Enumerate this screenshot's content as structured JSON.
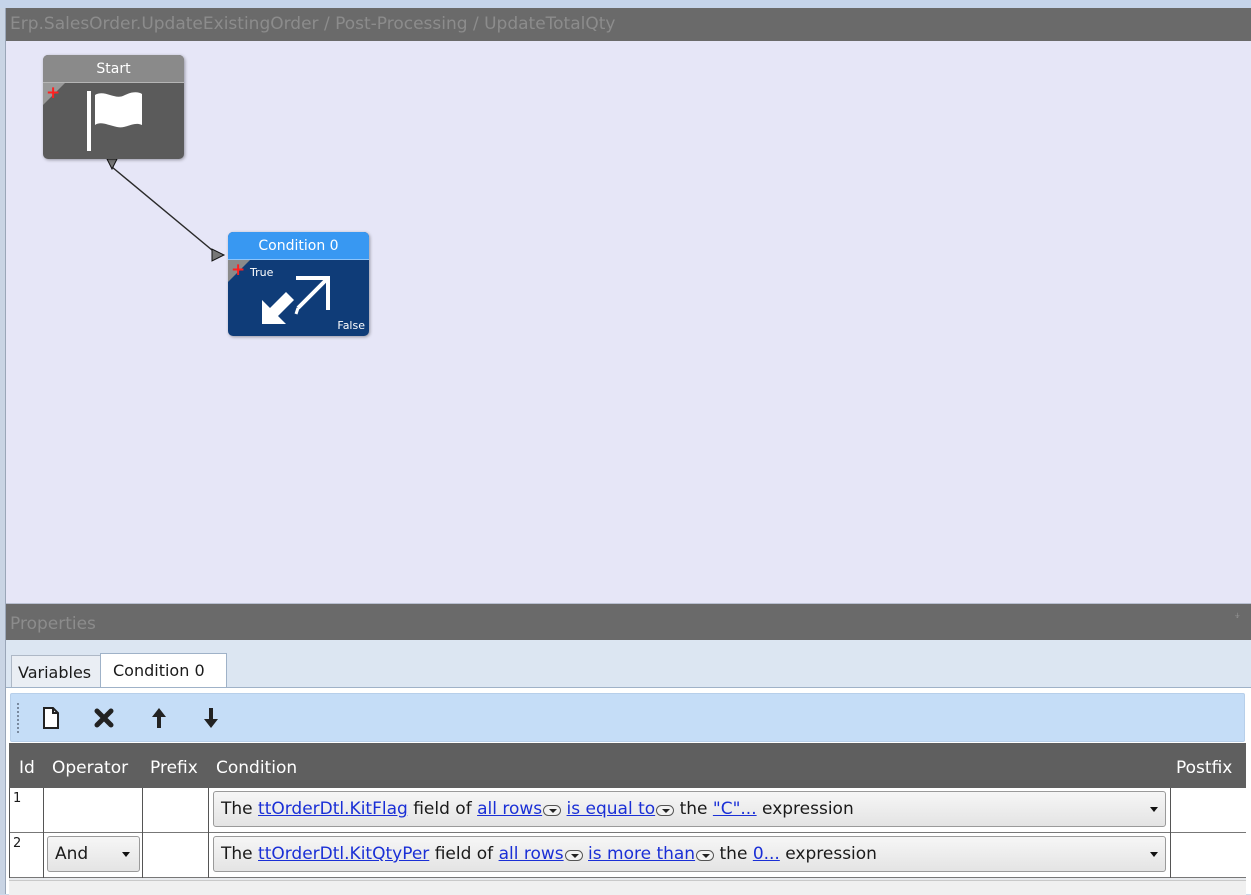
{
  "breadcrumb": "Erp.SalesOrder.UpdateExistingOrder / Post-Processing / UpdateTotalQty",
  "canvas": {
    "nodes": [
      {
        "title": "Start",
        "icon": "flag-icon"
      },
      {
        "title": "Condition 0",
        "icon": "condition-arrows-icon",
        "true_label": "True",
        "false_label": "False"
      }
    ],
    "add_glyph": "+"
  },
  "properties": {
    "title": "Properties",
    "pin_glyph": "⍖",
    "tabs": [
      {
        "label": "Variables",
        "selected": false
      },
      {
        "label": "Condition 0",
        "selected": true
      }
    ],
    "toolbar": [
      "new-icon",
      "delete-icon",
      "move-up-icon",
      "move-down-icon"
    ],
    "columns": {
      "id": "Id",
      "operator": "Operator",
      "prefix": "Prefix",
      "condition": "Condition",
      "postfix": "Postfix"
    },
    "rows": [
      {
        "id": "1",
        "operator": "",
        "prefix": "",
        "condition": {
          "p1": "The ",
          "field": "ttOrderDtl.KitFlag",
          "p2": " field of ",
          "rows": "all rows",
          "p3": " ",
          "compare": "is equal to",
          "p4": " the ",
          "value": "\"C\"...",
          "p5": " expression"
        },
        "postfix": ""
      },
      {
        "id": "2",
        "operator": "And",
        "prefix": "",
        "condition": {
          "p1": "The ",
          "field": "ttOrderDtl.KitQtyPer",
          "p2": " field of ",
          "rows": "all rows",
          "p3": " ",
          "compare": "is more than",
          "p4": " the ",
          "value": "0...",
          "p5": " expression"
        },
        "postfix": ""
      }
    ]
  },
  "colors": {
    "canvas_bg": "#e6e6f7",
    "start_node": "#5b5b5b",
    "condition_node": "#0f3c78",
    "condition_title": "#3898f2",
    "link": "#1a2fd6",
    "grid_header": "#5f5f5f",
    "toolbar_bg": "#c5ddf7"
  }
}
